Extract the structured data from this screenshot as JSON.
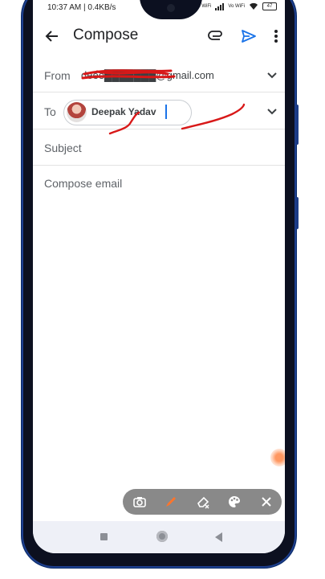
{
  "status_bar": {
    "time_speed": "10:37 AM | 0.4KB/s",
    "battery": "47",
    "network_label_1": "Vo WiFi",
    "network_label_2": "Vo WiFi"
  },
  "appbar": {
    "title": "Compose",
    "back_icon": "arrow-back-icon",
    "attach_icon": "paperclip-icon",
    "send_icon": "send-icon",
    "more_icon": "more-vert-icon"
  },
  "from": {
    "label": "From",
    "value": "deee███████@gmail.com"
  },
  "to": {
    "label": "To",
    "recipient_name": "Deepak Yadav"
  },
  "subject": {
    "placeholder": "Subject"
  },
  "body": {
    "placeholder": "Compose email"
  },
  "annotation_toolbar": {
    "tools": [
      "camera-icon",
      "pen-icon",
      "eraser-icon",
      "palette-icon",
      "close-icon"
    ]
  },
  "colors": {
    "accent": "#1a73e8",
    "annotation_red": "#d81818",
    "toolbar_bg": "#7f7f7f",
    "pen_orange": "#ff6a1a"
  }
}
